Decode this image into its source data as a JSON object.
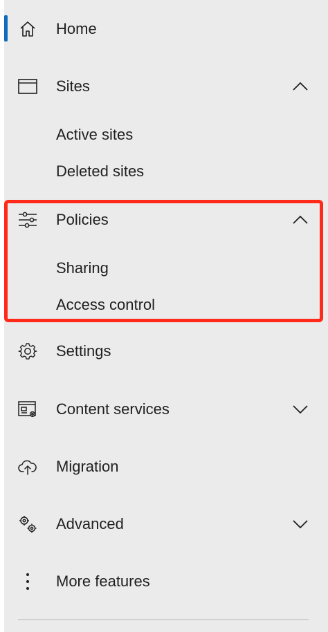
{
  "nav": {
    "home": {
      "label": "Home",
      "icon": "home-icon"
    },
    "sites": {
      "label": "Sites",
      "icon": "browser-window-icon",
      "expanded": true,
      "children": [
        {
          "label": "Active sites"
        },
        {
          "label": "Deleted sites"
        }
      ]
    },
    "policies": {
      "label": "Policies",
      "icon": "sliders-icon",
      "expanded": true,
      "children": [
        {
          "label": "Sharing"
        },
        {
          "label": "Access control"
        }
      ]
    },
    "settings": {
      "label": "Settings",
      "icon": "gear-icon"
    },
    "content_services": {
      "label": "Content services",
      "icon": "content-services-icon",
      "expanded": false
    },
    "migration": {
      "label": "Migration",
      "icon": "cloud-upload-icon"
    },
    "advanced": {
      "label": "Advanced",
      "icon": "gears-icon",
      "expanded": false
    },
    "more_features": {
      "label": "More features",
      "icon": "more-vertical-icon"
    }
  },
  "colors": {
    "background": "#ebebeb",
    "accent": "#0f6cbd",
    "highlight": "#ff2a1a",
    "text": "#1f1f1f"
  }
}
